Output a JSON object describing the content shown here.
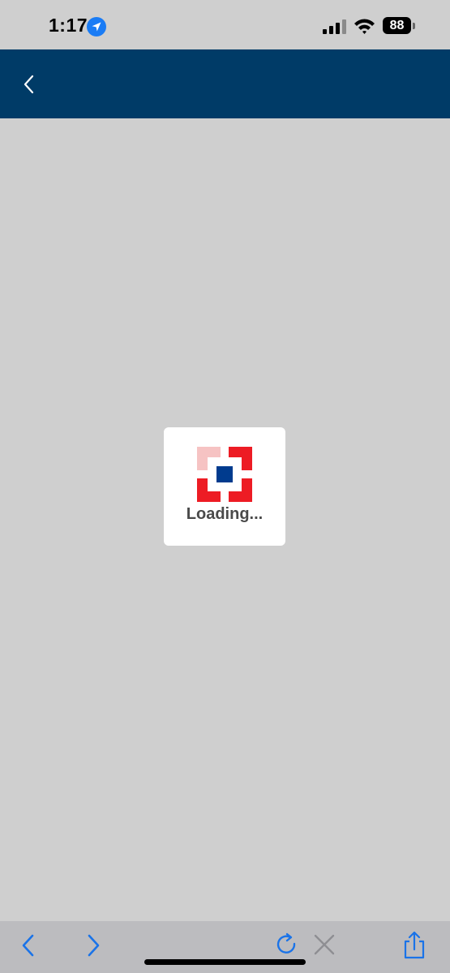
{
  "status_bar": {
    "time": "1:17",
    "battery_level": "88",
    "icons": [
      "location-arrow-icon",
      "cellular-signal-icon",
      "wifi-icon",
      "battery-icon"
    ]
  },
  "header": {
    "background_color": "#003b67",
    "back_icon": "chevron-left-icon"
  },
  "loader": {
    "text": "Loading...",
    "logo": "bank-logo-icon",
    "logo_colors": {
      "red": "#ed1c24",
      "light_red": "#f6c3c3",
      "blue": "#003b8e"
    }
  },
  "toolbar": {
    "icons": [
      "back-chevron-icon",
      "forward-chevron-icon",
      "reload-icon",
      "stop-icon",
      "share-icon"
    ],
    "accent_color": "#1a73e8"
  }
}
